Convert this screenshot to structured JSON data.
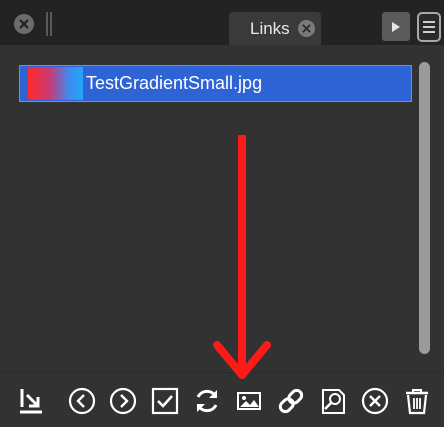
{
  "panel": {
    "tab_label": "Links"
  },
  "links": [
    {
      "filename": "TestGradientSmall.jpg"
    }
  ],
  "toolbar": {
    "buttons": [
      {
        "icon": "relink-icon"
      },
      {
        "icon": "previous-icon"
      },
      {
        "icon": "next-icon"
      },
      {
        "icon": "checkbox-icon"
      },
      {
        "icon": "refresh-icon"
      },
      {
        "icon": "image-icon"
      },
      {
        "icon": "link-icon"
      },
      {
        "icon": "find-document-icon"
      },
      {
        "icon": "remove-icon"
      },
      {
        "icon": "trash-icon"
      }
    ]
  },
  "annotation": {
    "arrow_color": "#ff1a1a"
  },
  "colors": {
    "selection": "#2e63d6",
    "panel_bg": "#323232",
    "titlebar_bg": "#232323"
  }
}
